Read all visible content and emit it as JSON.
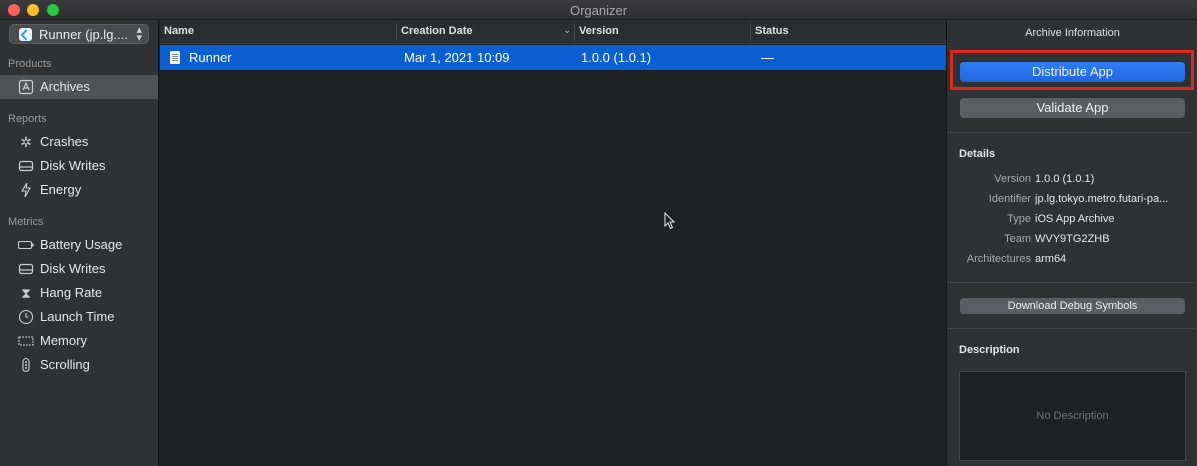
{
  "window": {
    "title": "Organizer"
  },
  "sidebar": {
    "scheme_label": "Runner (jp.lg....",
    "sections": {
      "products": "Products",
      "reports": "Reports",
      "metrics": "Metrics"
    },
    "products": [
      {
        "label": "Archives",
        "icon": "archive-icon"
      }
    ],
    "reports": [
      {
        "label": "Crashes",
        "icon": "crash-icon"
      },
      {
        "label": "Disk Writes",
        "icon": "disk-icon"
      },
      {
        "label": "Energy",
        "icon": "bolt-icon"
      }
    ],
    "metrics": [
      {
        "label": "Battery Usage",
        "icon": "battery-icon"
      },
      {
        "label": "Disk Writes",
        "icon": "disk-icon"
      },
      {
        "label": "Hang Rate",
        "icon": "hourglass-icon"
      },
      {
        "label": "Launch Time",
        "icon": "clock-icon"
      },
      {
        "label": "Memory",
        "icon": "memory-icon"
      },
      {
        "label": "Scrolling",
        "icon": "scroll-icon"
      }
    ]
  },
  "table": {
    "columns": [
      "Name",
      "Creation Date",
      "Version",
      "Status"
    ],
    "rows": [
      {
        "name": "Runner",
        "creation_date": "Mar 1, 2021 10:09",
        "version": "1.0.0 (1.0.1)",
        "status": "—"
      }
    ]
  },
  "inspector": {
    "title": "Archive Information",
    "distribute_label": "Distribute App",
    "validate_label": "Validate App",
    "details_heading": "Details",
    "details": [
      {
        "key": "Version",
        "value": "1.0.0 (1.0.1)"
      },
      {
        "key": "Identifier",
        "value": "jp.lg.tokyo.metro.futari-pa..."
      },
      {
        "key": "Type",
        "value": "iOS App Archive"
      },
      {
        "key": "Team",
        "value": "WVY9TG2ZHB"
      },
      {
        "key": "Architectures",
        "value": "arm64"
      }
    ],
    "download_label": "Download Debug Symbols",
    "description_heading": "Description",
    "description_placeholder": "No Description"
  },
  "colors": {
    "accent": "#1f66de",
    "selection": "#0b5fd1",
    "highlight_box": "#e1261c"
  }
}
